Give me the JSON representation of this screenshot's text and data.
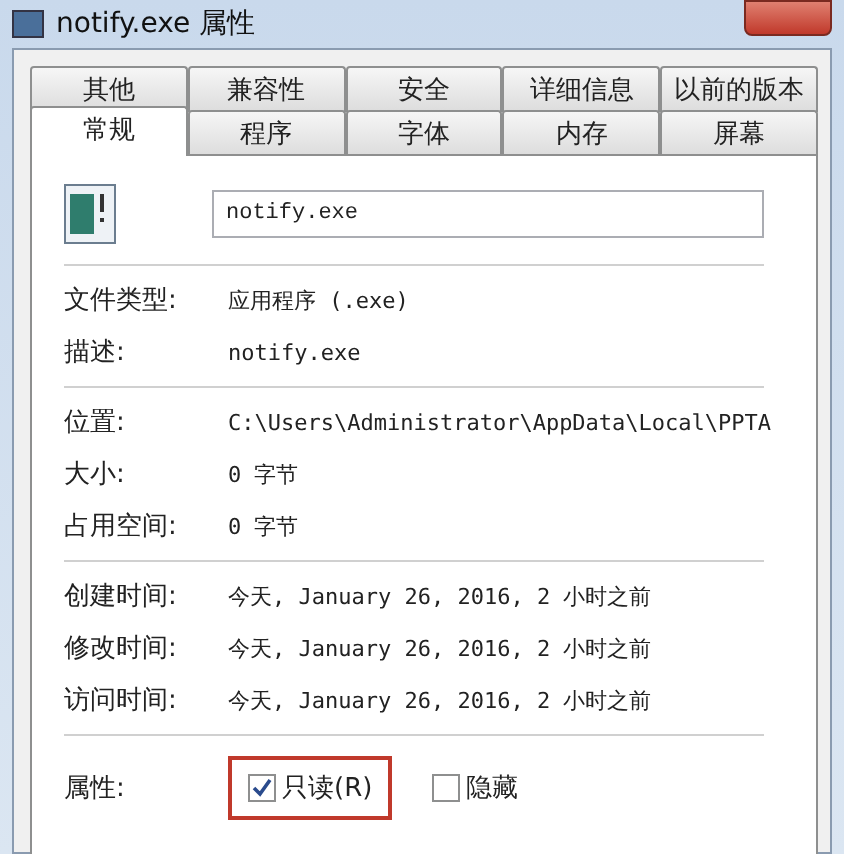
{
  "window": {
    "title": "notify.exe 属性"
  },
  "tabs_back": [
    {
      "label": "其他",
      "selected": false
    },
    {
      "label": "兼容性",
      "selected": false
    },
    {
      "label": "安全",
      "selected": false
    },
    {
      "label": "详细信息",
      "selected": false
    },
    {
      "label": "以前的版本",
      "selected": false
    }
  ],
  "tabs_front": [
    {
      "label": "常规",
      "selected": true
    },
    {
      "label": "程序",
      "selected": false
    },
    {
      "label": "字体",
      "selected": false
    },
    {
      "label": "内存",
      "selected": false
    },
    {
      "label": "屏幕",
      "selected": false
    }
  ],
  "file_name": "notify.exe",
  "groups": [
    [
      {
        "label": "文件类型:",
        "value": "应用程序 (.exe)"
      },
      {
        "label": "描述:",
        "value": "notify.exe"
      }
    ],
    [
      {
        "label": "位置:",
        "value": "C:\\Users\\Administrator\\AppData\\Local\\PPTA"
      },
      {
        "label": "大小:",
        "value": "0 字节"
      },
      {
        "label": "占用空间:",
        "value": "0 字节"
      }
    ],
    [
      {
        "label": "创建时间:",
        "value": "今天, January 26, 2016, 2 小时之前"
      },
      {
        "label": "修改时间:",
        "value": "今天, January 26, 2016, 2 小时之前"
      },
      {
        "label": "访问时间:",
        "value": "今天, January 26, 2016, 2 小时之前"
      }
    ]
  ],
  "attributes": {
    "label": "属性:",
    "items": [
      {
        "label": "只读(R)",
        "checked": true,
        "highlighted": true
      },
      {
        "label": "隐藏",
        "checked": false,
        "highlighted": false
      }
    ]
  }
}
